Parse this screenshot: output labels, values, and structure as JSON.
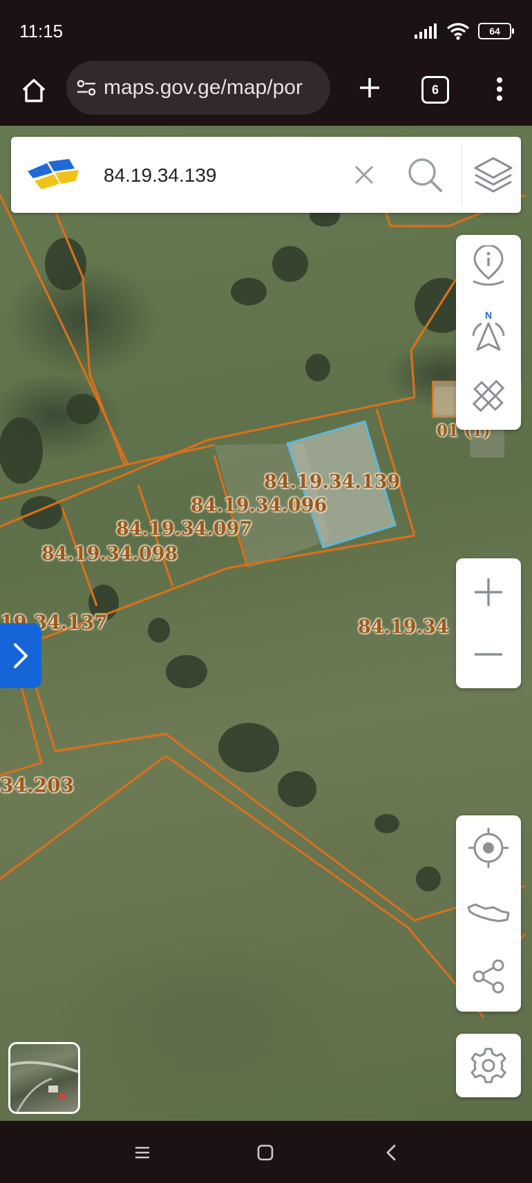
{
  "status_bar": {
    "time": "11:15",
    "battery": "64"
  },
  "browser": {
    "url": "maps.gov.ge/map/por",
    "tab_count": "6"
  },
  "search": {
    "value": "84.19.34.139"
  },
  "parcels": {
    "p139": "84.19.34.139",
    "p096": "84.19.34.096",
    "p097": "84.19.34.097",
    "p098": "84.19.34.098",
    "p137": "19.34.137",
    "p_east": "84.19.34",
    "p203": "34.203",
    "building": "01 (1)"
  },
  "icons": {
    "home": "home-icon",
    "tune": "tune-icon",
    "plus": "plus-icon",
    "tabs": "tabs-icon",
    "menu": "more-vert-icon",
    "logo": "napr-logo-icon",
    "clear": "close-icon",
    "search": "search-icon",
    "layers": "layers-icon",
    "info": "info-location-icon",
    "compass": "compass-north-icon",
    "measure": "ruler-pencil-icon",
    "zoom_in": "zoom-in-icon",
    "zoom_out": "zoom-out-icon",
    "locate": "my-location-icon",
    "country": "georgia-map-icon",
    "share": "share-icon",
    "settings": "gear-icon",
    "chevron": "chevron-right-icon"
  },
  "colors": {
    "parcel_border": "#d8701c",
    "selected_parcel": "#5eb8d8",
    "sidebar_toggle": "#1565d8",
    "parcel_label": "#9a5a1e"
  }
}
